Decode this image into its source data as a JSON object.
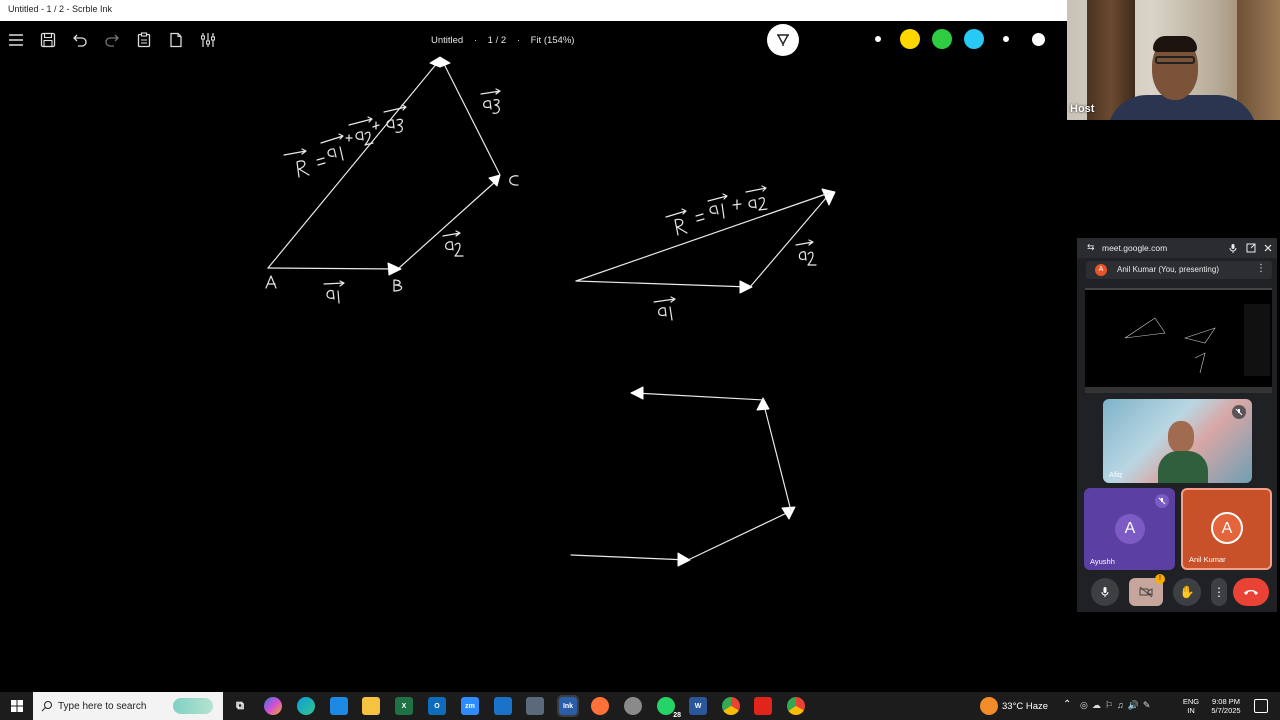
{
  "window": {
    "title": "Untitled - 1 / 2 - Scrble Ink"
  },
  "toolbar": {
    "doc_name": "Untitled",
    "separator": "·",
    "page": "1 / 2",
    "zoom": "Fit (154%)",
    "icons": [
      "menu-icon",
      "save-icon",
      "undo-icon",
      "redo-icon",
      "paste-icon",
      "new-page-icon",
      "settings-sliders-icon"
    ],
    "swatches": [
      "#000000",
      "#000000",
      "#ffffff",
      "#ffd700",
      "#2ecc40",
      "#29c9f5",
      "#ffffff",
      "#ffffff"
    ]
  },
  "canvas": {
    "labels": {
      "a3": "a3",
      "R1": "R = a1 + a2 + a3",
      "C": "C",
      "A": "A",
      "B": "B",
      "a1": "a1",
      "a2": "a2",
      "R2": "R = a1 + a2",
      "a2b": "a2",
      "a1b": "a1"
    }
  },
  "webcam": {
    "label": "Host"
  },
  "meet": {
    "url": "meet.google.com",
    "presenter": "Anil Kumar (You, presenting)",
    "presenter_initial": "A",
    "participants": [
      {
        "name": "Afiq"
      },
      {
        "name": "Ayushh",
        "initial": "A"
      },
      {
        "name": "Anil Kumar",
        "initial": "A"
      }
    ]
  },
  "taskbar": {
    "search_placeholder": "Type here to search",
    "whatsapp_badge": "28",
    "weather": "33°C  Haze",
    "lang_1": "ENG",
    "lang_2": "IN",
    "time": "9:08 PM",
    "date": "5/7/2025"
  }
}
